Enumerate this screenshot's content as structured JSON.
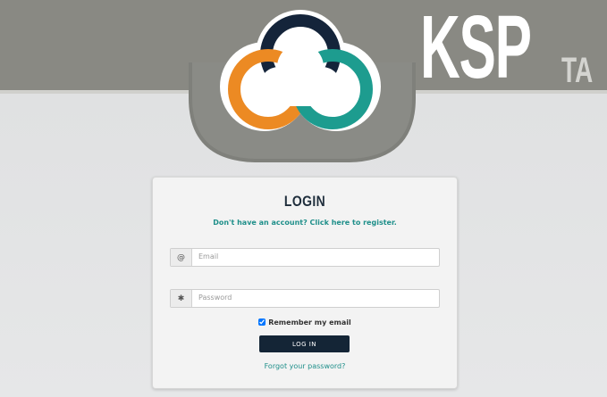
{
  "brand": {
    "main": "KSP",
    "sub": "TA"
  },
  "logo": {
    "icon": "cloud-logo-icon",
    "colors": {
      "navy": "#14243a",
      "orange": "#ec8a23",
      "teal": "#1d9c8f",
      "plate": "#7f807b",
      "band": "#898983"
    }
  },
  "login": {
    "title": "LOGIN",
    "register_text": "Don't have an account? Click here to register.",
    "email": {
      "icon": "at-sign-icon",
      "icon_glyph": "@",
      "placeholder": "Email",
      "value": ""
    },
    "password": {
      "icon": "asterisk-icon",
      "icon_glyph": "✱",
      "placeholder": "Password",
      "value": ""
    },
    "remember_label": "Remember my email",
    "remember_checked": true,
    "submit_label": "LOG IN",
    "forgot_text": "Forgot your password?",
    "accent_color": "#1f8f8a",
    "button_color": "#142536"
  }
}
